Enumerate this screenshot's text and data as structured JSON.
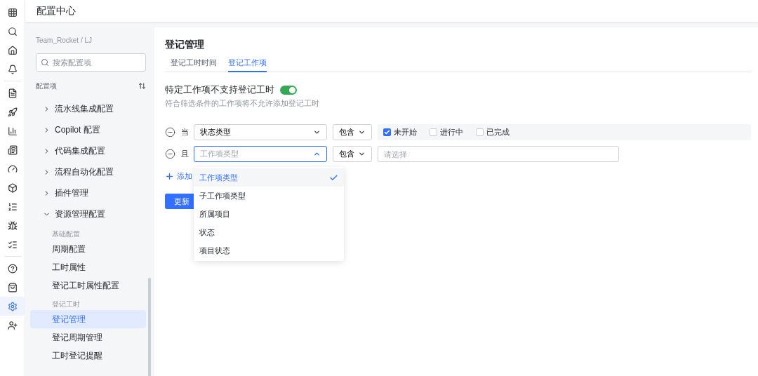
{
  "header": {
    "title": "配置中心"
  },
  "rail": [
    {
      "kind": "grid",
      "selected": false
    },
    {
      "kind": "search",
      "selected": false
    },
    {
      "kind": "home",
      "selected": false
    },
    {
      "kind": "bell",
      "selected": false
    },
    {
      "kind": "divider"
    },
    {
      "kind": "file",
      "selected": false
    },
    {
      "kind": "rocket",
      "selected": false
    },
    {
      "kind": "chart",
      "selected": false
    },
    {
      "kind": "news",
      "selected": false
    },
    {
      "kind": "gauge",
      "selected": false
    },
    {
      "kind": "box",
      "selected": false
    },
    {
      "kind": "list",
      "selected": false
    },
    {
      "kind": "bug",
      "selected": false
    },
    {
      "kind": "checks",
      "selected": false
    },
    {
      "kind": "divider"
    },
    {
      "kind": "help",
      "selected": false
    },
    {
      "kind": "bag",
      "selected": false
    },
    {
      "kind": "settings",
      "selected": true
    },
    {
      "kind": "user",
      "selected": false
    }
  ],
  "sidebar": {
    "breadcrumb": "Team_Rocket / LJ",
    "search": {
      "placeholder": "搜索配置项"
    },
    "section": "配置项",
    "items": [
      {
        "label": "流水线集成配置",
        "expanded": false
      },
      {
        "label": "Copilot 配置",
        "expanded": false
      },
      {
        "label": "代码集成配置",
        "expanded": false
      },
      {
        "label": "流程自动化配置",
        "expanded": false
      },
      {
        "label": "插件管理",
        "expanded": false
      },
      {
        "label": "资源管理配置",
        "expanded": true,
        "children": [
          {
            "group": "基础配置",
            "children": [
              {
                "label": "周期配置",
                "selected": false
              },
              {
                "label": "工时属性",
                "selected": false
              },
              {
                "label": "登记工时属性配置",
                "selected": false
              }
            ]
          },
          {
            "group": "登记工时",
            "children": [
              {
                "label": "登记管理",
                "selected": true
              },
              {
                "label": "登记周期管理",
                "selected": false
              },
              {
                "label": "工时登记提醒",
                "selected": false
              }
            ]
          }
        ]
      }
    ]
  },
  "main": {
    "title": "登记管理",
    "tabs": [
      {
        "label": "登记工时时间",
        "selected": false
      },
      {
        "label": "登记工作项",
        "selected": true
      }
    ],
    "setting": {
      "title": "特定工作项不支持登记工时",
      "on": true,
      "description": "符合筛选条件的工作项将不允许添加登记工时"
    },
    "conditions": [
      {
        "connector": "当",
        "field": {
          "value": "状态类型",
          "open": false
        },
        "operator": "包含",
        "kind": "checkboxes",
        "options": [
          {
            "label": "未开始",
            "checked": true
          },
          {
            "label": "进行中",
            "checked": false
          },
          {
            "label": "已完成",
            "checked": false
          }
        ]
      },
      {
        "connector": "且",
        "field": {
          "placeholder": "工作项类型",
          "open": true
        },
        "operator": "包含",
        "kind": "select",
        "placeholder": "请选择"
      }
    ],
    "add": "添加",
    "submit": "更新",
    "dropdown": [
      {
        "label": "工作项类型",
        "selected": true
      },
      {
        "label": "子工作项类型",
        "selected": false
      },
      {
        "label": "所属项目",
        "selected": false
      },
      {
        "label": "状态",
        "selected": false
      },
      {
        "label": "项目状态",
        "selected": false
      }
    ]
  }
}
